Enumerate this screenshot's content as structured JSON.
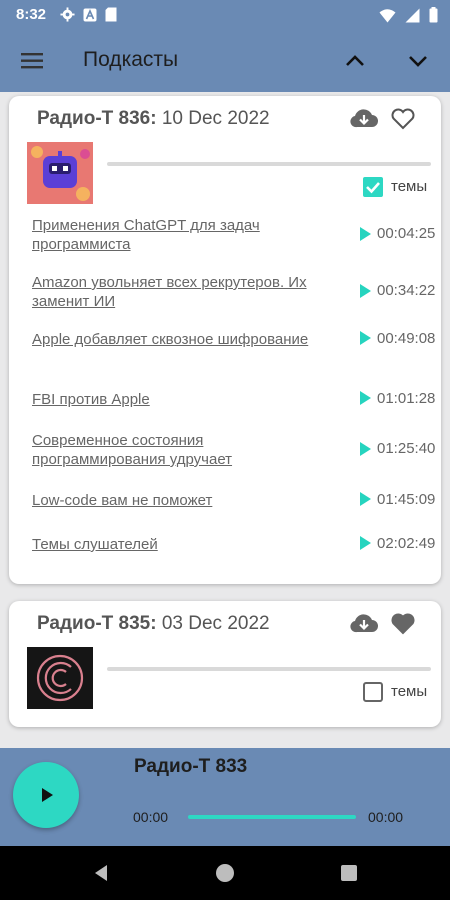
{
  "status_bar": {
    "time": "8:32",
    "left_icons": [
      "gear-icon",
      "a-badge-icon",
      "sd-card-icon"
    ],
    "right_icons": [
      "wifi-icon",
      "signal-icon",
      "battery-icon"
    ]
  },
  "app_bar": {
    "title": "Подкасты",
    "menu_icon": "menu-icon",
    "up_icon": "chevron-up-icon",
    "down_icon": "chevron-down-icon"
  },
  "episodes": [
    {
      "name": "Радио-Т 836:",
      "date": "10 Dec 2022",
      "favorite": false,
      "topics_checked": true,
      "topics_label": "темы",
      "topics": [
        {
          "title": "Применения ChatGPT для задач программиста",
          "time": "00:04:25"
        },
        {
          "title": "Amazon увольняет всех рекрутеров. Их заменит ИИ",
          "time": "00:34:22"
        },
        {
          "title": "Apple добавляет сквозное шифрование",
          "time": "00:49:08"
        },
        {
          "title": "FBI против Apple",
          "time": "01:01:28"
        },
        {
          "title": "Современное состояния программирования удручает",
          "time": "01:25:40"
        },
        {
          "title": "Low-code вам не поможет",
          "time": "01:45:09"
        },
        {
          "title": "Темы слушателей",
          "time": "02:02:49"
        }
      ]
    },
    {
      "name": "Радио-Т 835:",
      "date": "03 Dec 2022",
      "favorite": true,
      "topics_checked": false,
      "topics_label": "темы",
      "topics": []
    }
  ],
  "player": {
    "title": "Радио-Т 833",
    "position": "00:00",
    "duration": "00:00"
  },
  "colors": {
    "primary": "#6a8ab4",
    "accent": "#2dd8c3",
    "text": "#555555"
  }
}
